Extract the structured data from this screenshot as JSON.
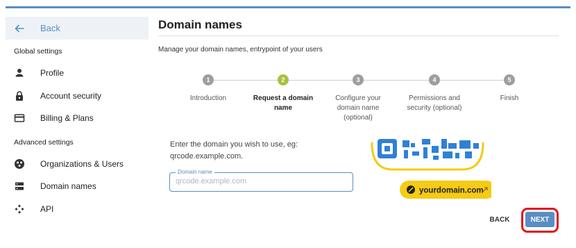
{
  "sidebar": {
    "back_label": "Back",
    "sections": [
      {
        "title": "Global settings"
      },
      {
        "title": "Advanced settings"
      }
    ],
    "items": [
      {
        "label": "Profile",
        "icon": "person-icon"
      },
      {
        "label": "Account security",
        "icon": "lock-icon"
      },
      {
        "label": "Billing & Plans",
        "icon": "credit-card-icon"
      },
      {
        "label": "Organizations & Users",
        "icon": "organization-icon"
      },
      {
        "label": "Domain names",
        "icon": "dns-server-icon"
      },
      {
        "label": "API",
        "icon": "api-icon"
      }
    ]
  },
  "main": {
    "title": "Domain names",
    "subtitle": "Manage your domain names, entrypoint of your users",
    "steps": [
      {
        "number": "1",
        "label": "Introduction",
        "active": false
      },
      {
        "number": "2",
        "label": "Request a domain name",
        "active": true
      },
      {
        "number": "3",
        "label": "Configure your domain name (optional)",
        "active": false
      },
      {
        "number": "4",
        "label": "Permissions and security (optional)",
        "active": false
      },
      {
        "number": "5",
        "label": "Finish",
        "active": false
      }
    ],
    "instruction": "Enter the domain you wish to use, eg: qrcode.example.com.",
    "field": {
      "label": "Domain name",
      "placeholder": "qrcode.example.com",
      "value": ""
    },
    "graphic": {
      "badge_text": "yourdomain.com",
      "accent_color": "#f5cb14",
      "qr_color": "#2f80d8"
    },
    "buttons": {
      "back": "BACK",
      "next": "NEXT"
    }
  },
  "colors": {
    "primary": "#5a8ec3",
    "step_active": "#a7c23d",
    "step_inactive": "#9e9e9e",
    "highlight": "#e3141d"
  }
}
